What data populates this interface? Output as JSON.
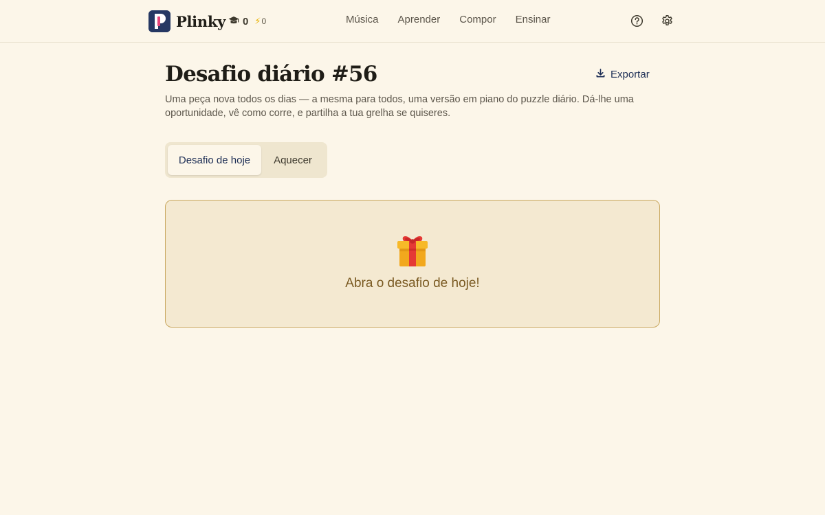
{
  "header": {
    "brand_name": "Plinky",
    "brand_logo_letter": "P",
    "xp_value": "0",
    "streak_value": "0",
    "nav": [
      {
        "label": "Música"
      },
      {
        "label": "Aprender"
      },
      {
        "label": "Compor"
      },
      {
        "label": "Ensinar"
      }
    ],
    "icons": [
      "help-icon",
      "settings-icon"
    ]
  },
  "main": {
    "title": "Desafio diário #56",
    "export_label": "Exportar",
    "subtitle": "Uma peça nova todos os dias — a mesma para todos, uma versão em piano do puzzle diário. Dá-lhe uma oportunidade, vê como corre, e partilha a tua grelha se quiseres.",
    "tabs": [
      {
        "label": "Desafio de hoje",
        "active": true
      },
      {
        "label": "Aquecer",
        "active": false
      }
    ],
    "card": {
      "icon": "gift-icon",
      "label": "Abra o desafio de hoje!"
    }
  },
  "colors": {
    "background": "#fcf6e9",
    "brand_navy": "#263863",
    "brand_pink": "#e8457a",
    "card_background": "#f4e9d1",
    "card_border": "#c9a860",
    "card_text": "#7a5a22"
  }
}
